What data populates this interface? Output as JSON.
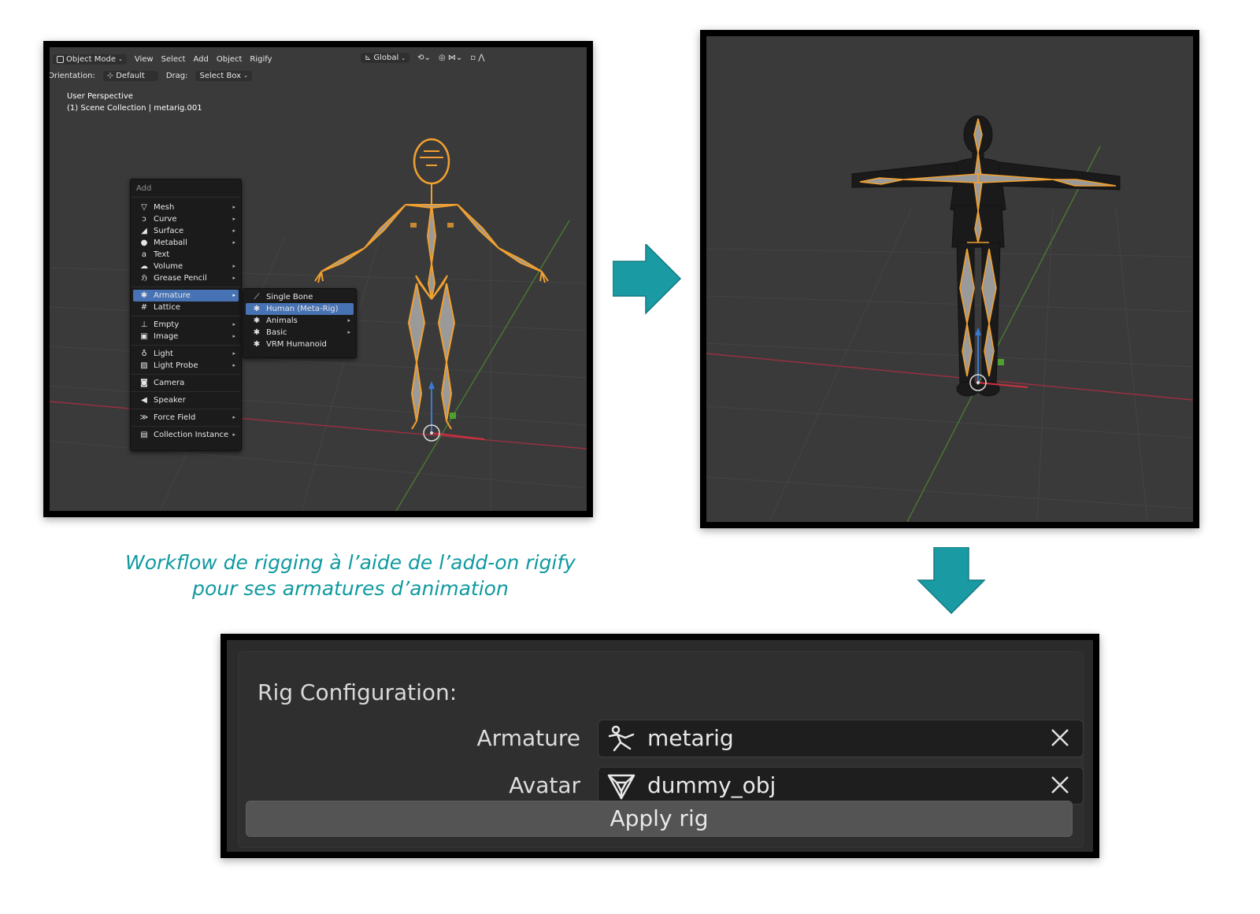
{
  "header": {
    "object_mode": "Object Mode",
    "menus": [
      "View",
      "Select",
      "Add",
      "Object",
      "Rigify"
    ],
    "orientation_label": "Orientation:",
    "orientation_value": "Default",
    "drag_label": "Drag:",
    "drag_value": "Select Box",
    "transform_orientation": "Global"
  },
  "viewport": {
    "perspective": "User Perspective",
    "collection": "(1) Scene Collection | metarig.001"
  },
  "add_menu": {
    "title": "Add",
    "items": [
      {
        "label": "Mesh",
        "icon": "mesh-icon",
        "glyph": "▽",
        "submenu": true
      },
      {
        "label": "Curve",
        "icon": "curve-icon",
        "glyph": "ↄ",
        "submenu": true
      },
      {
        "label": "Surface",
        "icon": "surface-icon",
        "glyph": "◢",
        "submenu": true
      },
      {
        "label": "Metaball",
        "icon": "metaball-icon",
        "glyph": "●",
        "submenu": true
      },
      {
        "label": "Text",
        "icon": "text-icon",
        "glyph": "a",
        "submenu": false
      },
      {
        "label": "Volume",
        "icon": "volume-icon",
        "glyph": "☁",
        "submenu": true
      },
      {
        "label": "Grease Pencil",
        "icon": "grease-pencil-icon",
        "glyph": "ℌ",
        "submenu": true
      },
      {
        "label": "Armature",
        "icon": "armature-icon",
        "glyph": "✱",
        "submenu": true,
        "selected": true
      },
      {
        "label": "Lattice",
        "icon": "lattice-icon",
        "glyph": "#",
        "submenu": false
      },
      {
        "label": "Empty",
        "icon": "empty-icon",
        "glyph": "⊥",
        "submenu": true
      },
      {
        "label": "Image",
        "icon": "image-icon",
        "glyph": "▣",
        "submenu": true
      },
      {
        "label": "Light",
        "icon": "light-icon",
        "glyph": "♁",
        "submenu": true
      },
      {
        "label": "Light Probe",
        "icon": "light-probe-icon",
        "glyph": "▨",
        "submenu": true
      },
      {
        "label": "Camera",
        "icon": "camera-icon",
        "glyph": "◙",
        "submenu": false
      },
      {
        "label": "Speaker",
        "icon": "speaker-icon",
        "glyph": "◀",
        "submenu": false
      },
      {
        "label": "Force Field",
        "icon": "force-field-icon",
        "glyph": "≫",
        "submenu": true
      },
      {
        "label": "Collection Instance",
        "icon": "collection-instance-icon",
        "glyph": "▤",
        "submenu": true
      }
    ]
  },
  "armature_submenu": {
    "items": [
      {
        "label": "Single Bone",
        "icon": "bone-icon",
        "submenu": false
      },
      {
        "label": "Human (Meta-Rig)",
        "icon": "armature-icon",
        "submenu": false,
        "selected": true
      },
      {
        "label": "Animals",
        "icon": "armature-icon",
        "submenu": true
      },
      {
        "label": "Basic",
        "icon": "armature-icon",
        "submenu": true
      },
      {
        "label": "VRM Humanoid",
        "icon": "armature-icon",
        "submenu": false
      }
    ]
  },
  "caption": {
    "line1": "Workflow de rigging à l’aide de l’add-on rigify",
    "line2": "pour ses armatures d’animation"
  },
  "rig_panel": {
    "title": "Rig Configuration:",
    "armature_label": "Armature",
    "armature_value": "metarig",
    "avatar_label": "Avatar",
    "avatar_value": "dummy_obj",
    "apply_label": "Apply rig"
  },
  "colors": {
    "accent_teal": "#0f9aa0",
    "arrow_teal": "#1a9aa3",
    "bone_orange": "#f0a030",
    "menu_selected": "#4772b3",
    "viewport_bg": "#3a3a3a"
  }
}
